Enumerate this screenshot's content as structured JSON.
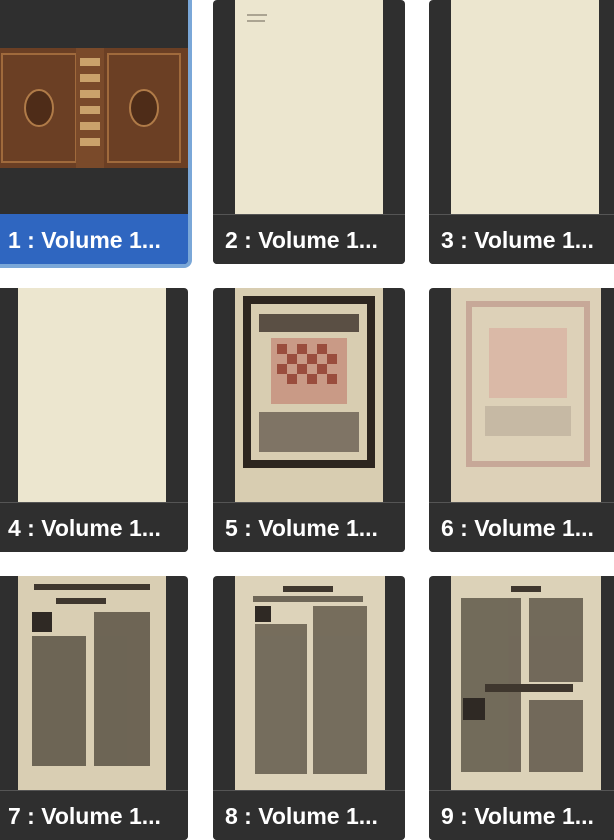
{
  "thumbnails": [
    {
      "index": 1,
      "label": "1 : Volume 1...",
      "kind": "binding",
      "selected": true
    },
    {
      "index": 2,
      "label": "2 : Volume 1...",
      "kind": "blank",
      "selected": false
    },
    {
      "index": 3,
      "label": "3 : Volume 1...",
      "kind": "blank",
      "selected": false
    },
    {
      "index": 4,
      "label": "4 : Volume 1...",
      "kind": "blank",
      "selected": false
    },
    {
      "index": 5,
      "label": "5 : Volume 1...",
      "kind": "title-page",
      "selected": false
    },
    {
      "index": 6,
      "label": "6 : Volume 1...",
      "kind": "title-page-faded",
      "selected": false
    },
    {
      "index": 7,
      "label": "7 : Volume 1...",
      "kind": "text-page",
      "selected": false
    },
    {
      "index": 8,
      "label": "8 : Volume 1...",
      "kind": "text-page",
      "selected": false
    },
    {
      "index": 9,
      "label": "9 : Volume 1...",
      "kind": "text-page",
      "selected": false
    }
  ],
  "colors": {
    "tile_bg": "#2f2f2f",
    "selected_caption": "#2f66c0",
    "selected_border": "#7aa7d8",
    "caption_text": "#ffffff"
  }
}
